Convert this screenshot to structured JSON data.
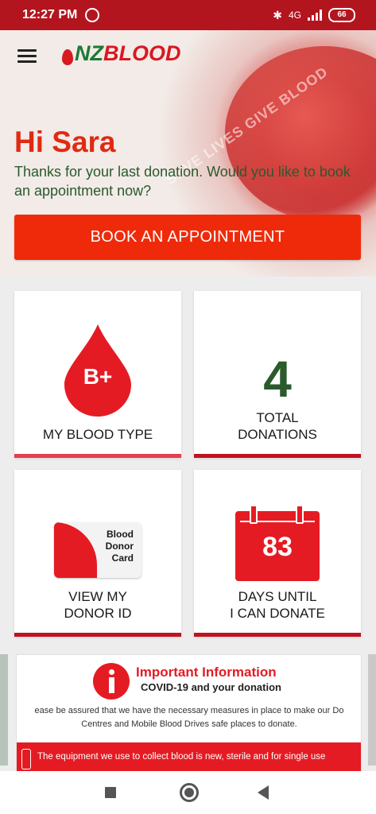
{
  "status_bar": {
    "time": "12:27 PM",
    "network": "4G",
    "battery": "66",
    "icons": [
      "alarm-icon",
      "bluetooth-icon",
      "signal-icon",
      "battery-icon"
    ]
  },
  "header": {
    "logo_nz": "NZ",
    "logo_blood": "BLOOD",
    "menu_icon": "hamburger-menu-icon"
  },
  "hero": {
    "greeting": "Hi Sara",
    "message": "Thanks for your last donation. Would you like to book an appointment now?",
    "background_text": "SAVE LIVES GIVE BLOOD",
    "book_button": "BOOK AN APPOINTMENT"
  },
  "tiles": {
    "blood_type": {
      "value": "B+",
      "label": "MY BLOOD TYPE"
    },
    "donations": {
      "value": "4",
      "label_line1": "TOTAL",
      "label_line2": "DONATIONS"
    },
    "donor_id": {
      "card_line1": "Blood",
      "card_line2": "Donor",
      "card_line3": "Card",
      "label_line1": "VIEW MY",
      "label_line2": "DONOR ID"
    },
    "days_until": {
      "value": "83",
      "label_line1": "DAYS UNTIL",
      "label_line2": "I CAN DONATE"
    }
  },
  "info_card": {
    "title": "Important Information",
    "subtitle": "COVID-19 and your donation",
    "text_line1": "ease be assured that we have the necessary measures in place to make our Do",
    "text_line2": "Centres and Mobile Blood Drives safe places to donate.",
    "band_text": "The equipment we use to collect blood is new, sterile and for single use"
  },
  "colors": {
    "brand_red": "#e51b23",
    "button_red": "#ef2a0a",
    "brand_green": "#1b7a35",
    "status_bar": "#b3151e"
  }
}
